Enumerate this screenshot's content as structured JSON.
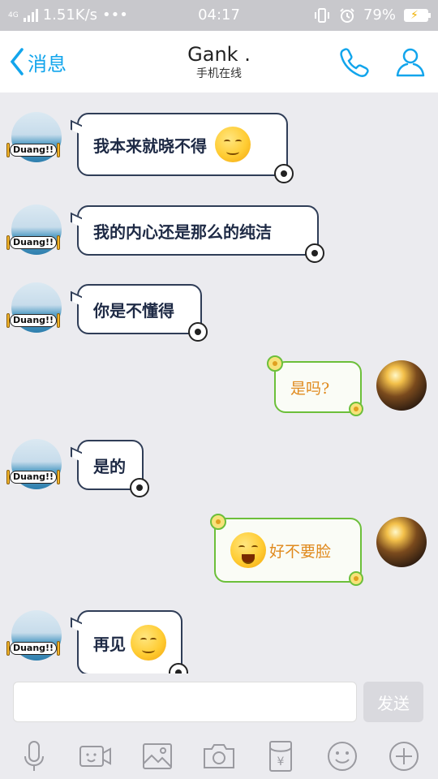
{
  "status_bar": {
    "network_label": "4G",
    "speed": "1.51K/s",
    "dots": "•••",
    "time": "04:17",
    "battery": "79%"
  },
  "header": {
    "back_label": "消息",
    "title": "Gank .",
    "subtitle": "手机在线"
  },
  "stickers": {
    "avatar_sticker_text": "Duang!!"
  },
  "messages": [
    {
      "side": "left",
      "text": "我本来就晓不得",
      "emoji": "relieved-face"
    },
    {
      "side": "left",
      "text": "我的内心还是那么的纯洁"
    },
    {
      "side": "left",
      "text": "你是不懂得"
    },
    {
      "side": "right",
      "text": "是吗?"
    },
    {
      "side": "left",
      "text": "是的"
    },
    {
      "side": "right",
      "text": "好不要脸",
      "emoji": "tears-of-joy-face"
    },
    {
      "side": "left",
      "text": "再见",
      "emoji": "hand-on-cheek-face"
    }
  ],
  "composer": {
    "input_value": "",
    "send_label": "发送"
  },
  "toolbar_icons": [
    "microphone-icon",
    "video-call-icon",
    "image-icon",
    "camera-icon",
    "red-packet-icon",
    "emoji-icon",
    "plus-icon"
  ],
  "colors": {
    "accent": "#12a5ec",
    "left_bubble_border": "#2f3d57",
    "right_bubble_border": "#6cbf3a",
    "right_text": "#e08a1e"
  }
}
